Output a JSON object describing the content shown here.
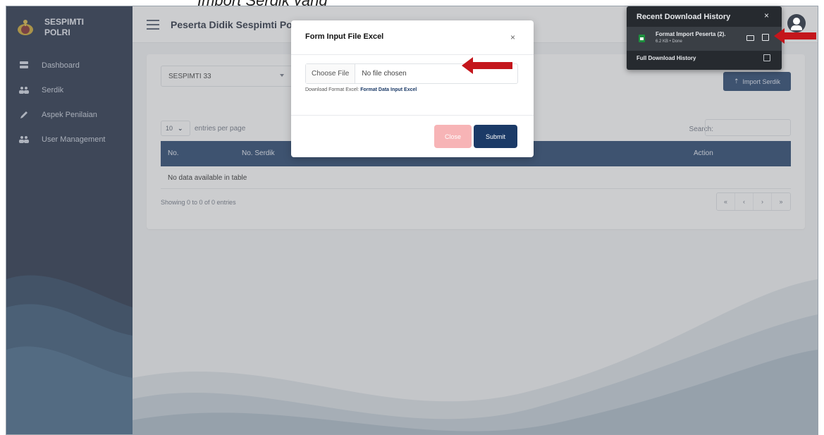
{
  "cropped_caption": "Import Serdik yang",
  "sidebar": {
    "brand_line1": "SESPIMTI",
    "brand_line2": "POLRI",
    "items": [
      {
        "label": "Dashboard",
        "icon": "dashboard-icon"
      },
      {
        "label": "Serdik",
        "icon": "users-icon"
      },
      {
        "label": "Aspek Penilaian",
        "icon": "pen-icon"
      },
      {
        "label": "User Management",
        "icon": "users-icon"
      }
    ]
  },
  "header": {
    "title": "Peserta Didik Sespimti Polri"
  },
  "content": {
    "select_value": "SESPIMTI 33",
    "import_button": "Import Serdik",
    "entries_value": "10",
    "entries_label": "entries per page",
    "search_label": "Search:",
    "columns": [
      "No.",
      "No. Serdik",
      "Action"
    ],
    "empty_text": "No data available in table",
    "showing_text": "Showing 0 to 0 of 0 entries",
    "pager": [
      "«",
      "‹",
      "›",
      "»"
    ]
  },
  "modal": {
    "title": "Form Input File Excel",
    "close_symbol": "×",
    "file_button": "Choose File",
    "file_status": "No file chosen",
    "hint_prefix": "Download Format Excel:",
    "hint_link": "Format Data Input Excel",
    "close_button": "Close",
    "submit_button": "Submit"
  },
  "download_panel": {
    "title": "Recent Download History",
    "close_symbol": "×",
    "file_name": "Format Import Peserta (2).",
    "file_meta": "6.2 KB • Done",
    "full_history": "Full Download History"
  },
  "colors": {
    "sidebar": "#1b2740",
    "primary": "#1b3a67",
    "close_button": "#f7b4b6",
    "annotation_arrow": "#c4161c"
  }
}
